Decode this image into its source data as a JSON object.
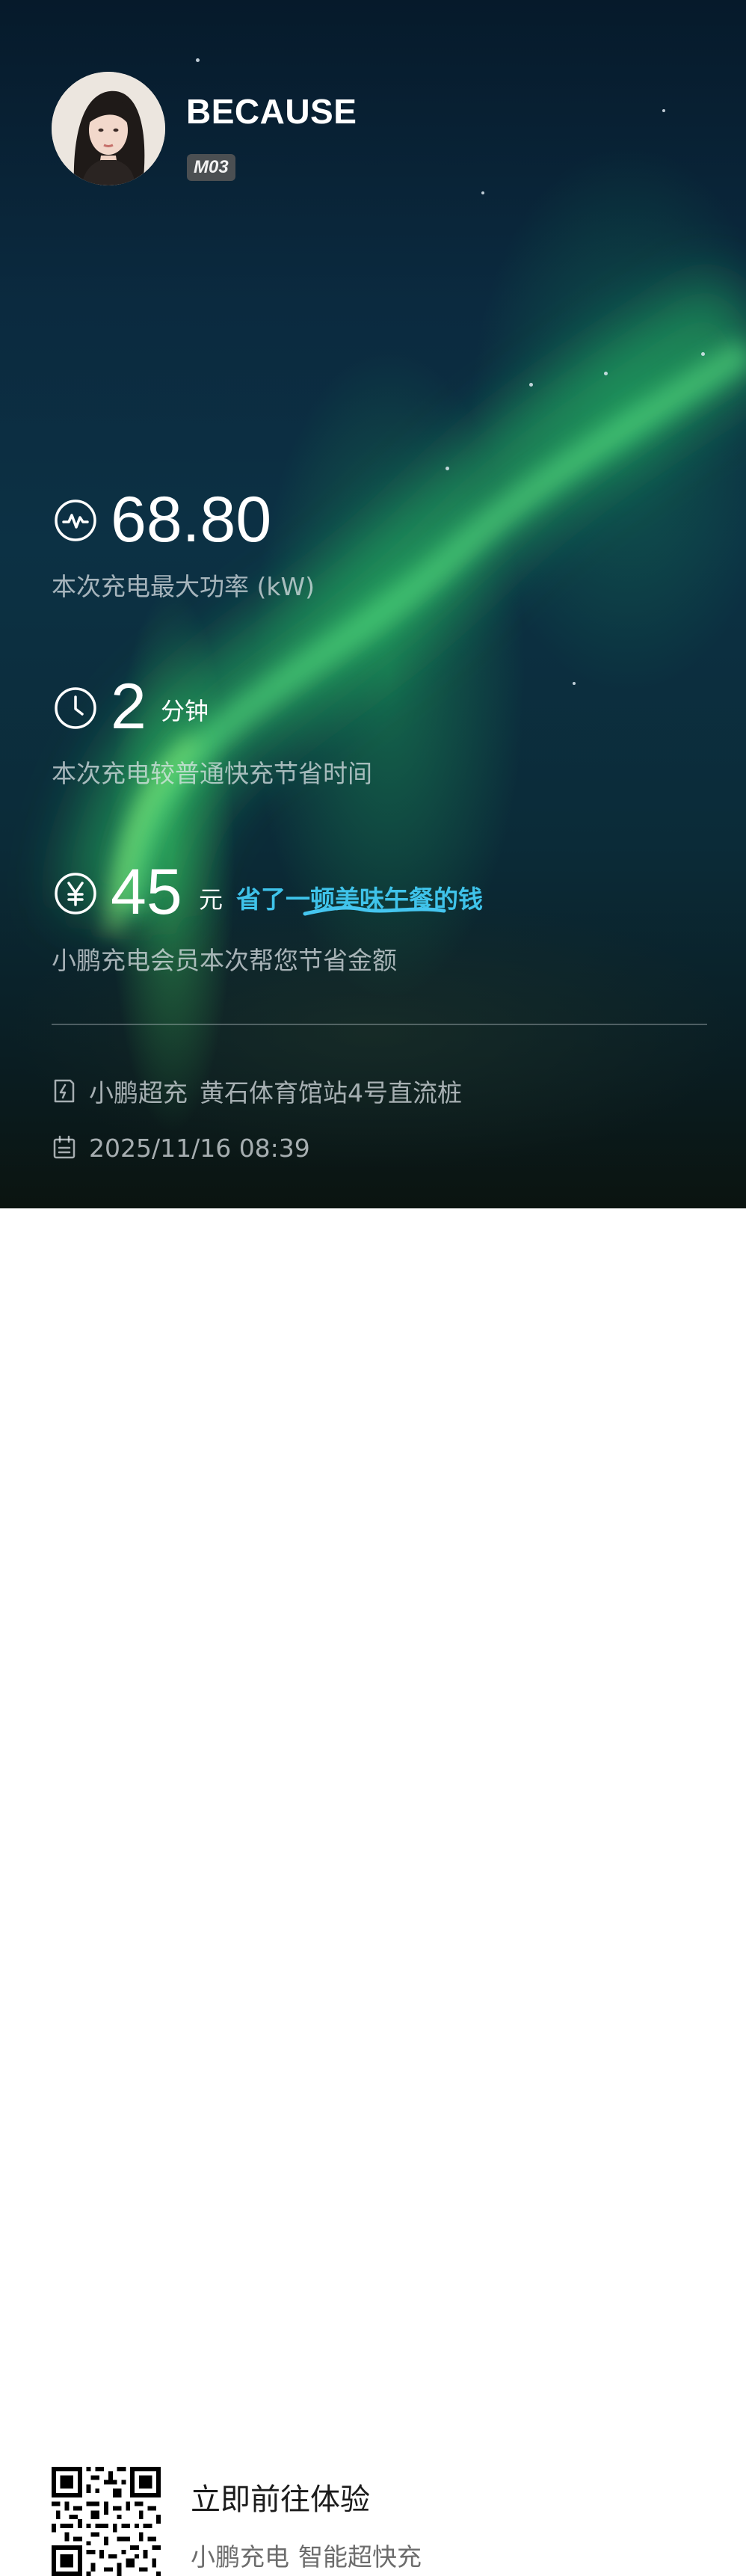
{
  "profile": {
    "username": "BECAUSE",
    "badge": "M03",
    "avatar_icon": "avatar-photo"
  },
  "stats": {
    "max_power": {
      "icon": "pulse-icon",
      "value": "68.80",
      "caption": "本次充电最大功率 (kW)"
    },
    "time_saved": {
      "icon": "clock-icon",
      "value": "2",
      "unit": "分钟",
      "caption": "本次充电较普通快充节省时间"
    },
    "money_saved": {
      "icon": "yen-icon",
      "value": "45",
      "unit": "元",
      "highlight": "省了一顿美味午餐的钱",
      "caption": "小鹏充电会员本次帮您节省金额"
    }
  },
  "details": {
    "station_brand": "小鹏超充",
    "station_name": "黄石体育馆站4号直流桩",
    "datetime": "2025/11/16 08:39"
  },
  "footer": {
    "cta_title": "立即前往体验",
    "brand": "小鹏充电",
    "slogan": "智能超快充"
  },
  "colors": {
    "highlight": "#3fc3ea",
    "background_top": "#061a2b",
    "aurora_green": "#1fa35c"
  }
}
